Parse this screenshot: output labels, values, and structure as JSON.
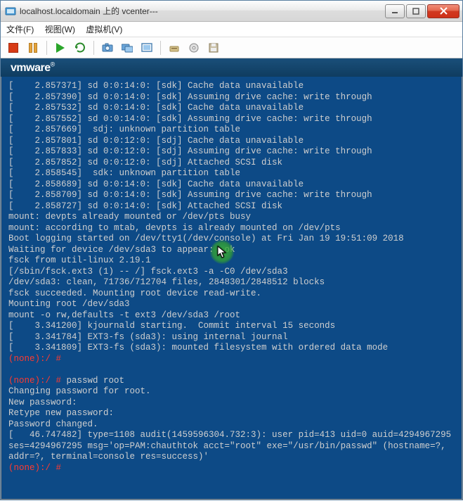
{
  "window": {
    "title": "localhost.localdomain 上的 vcenter---"
  },
  "menu": {
    "file": "文件(F)",
    "view": "视图(W)",
    "vm": "虚拟机(V)"
  },
  "toolbar_icons": {
    "stop": "stop-icon",
    "pause": "pause-icon",
    "play": "play-icon",
    "refresh": "refresh-icon",
    "snapshot": "snapshot-icon",
    "snapshot_mgr": "snapshot-manager-icon",
    "fullscreen": "fullscreen-icon",
    "eject": "eject-icon",
    "connect_cd": "connect-cd-icon",
    "connect_floppy": "connect-floppy-icon"
  },
  "vmware": {
    "brand": "vmware",
    "reg": "®"
  },
  "term": {
    "l01": "[    2.857371] sd 0:0:14:0: [sdk] Cache data unavailable",
    "l02": "[    2.857390] sd 0:0:14:0: [sdk] Assuming drive cache: write through",
    "l03": "[    2.857532] sd 0:0:14:0: [sdk] Cache data unavailable",
    "l04": "[    2.857552] sd 0:0:14:0: [sdk] Assuming drive cache: write through",
    "l05": "[    2.857669]  sdj: unknown partition table",
    "l06": "[    2.857801] sd 0:0:12:0: [sdj] Cache data unavailable",
    "l07": "[    2.857833] sd 0:0:12:0: [sdj] Assuming drive cache: write through",
    "l08": "[    2.857852] sd 0:0:12:0: [sdj] Attached SCSI disk",
    "l09": "[    2.858545]  sdk: unknown partition table",
    "l10": "[    2.858689] sd 0:0:14:0: [sdk] Cache data unavailable",
    "l11": "[    2.858709] sd 0:0:14:0: [sdk] Assuming drive cache: write through",
    "l12": "[    2.858727] sd 0:0:14:0: [sdk] Attached SCSI disk",
    "l13": "mount: devpts already mounted or /dev/pts busy",
    "l14": "mount: according to mtab, devpts is already mounted on /dev/pts",
    "l15": "Boot logging started on /dev/tty1(/dev/console) at Fri Jan 19 19:51:09 2018",
    "l16": "Waiting for device /dev/sda3 to appear:  ok",
    "l17": "fsck from util-linux 2.19.1",
    "l18": "[/sbin/fsck.ext3 (1) -- /] fsck.ext3 -a -C0 /dev/sda3",
    "l19": "/dev/sda3: clean, 71736/712704 files, 2848301/2848512 blocks",
    "l20": "fsck succeeded. Mounting root device read-write.",
    "l21": "Mounting root /dev/sda3",
    "l22": "mount -o rw,defaults -t ext3 /dev/sda3 /root",
    "l23": "[    3.341200] kjournald starting.  Commit interval 15 seconds",
    "l24": "[    3.341784] EXT3-fs (sda3): using internal journal",
    "l25": "[    3.341809] EXT3-fs (sda3): mounted filesystem with ordered data mode",
    "prompt1": "(none):/ #",
    "blank1": " ",
    "prompt2": "(none):/ #",
    "cmd_passwd": " passwd root",
    "l26": "Changing password for root.",
    "l27": "New password:",
    "l28": "Retype new password:",
    "l29": "Password changed.",
    "l30": "[   46.747482] type=1108 audit(1459596304.732:3): user pid=413 uid=0 auid=4294967295 ses=4294967295 msg='op=PAM:chauthtok acct=\"root\" exe=\"/usr/bin/passwd\" (hostname=?, addr=?, terminal=console res=success)'",
    "prompt3": "(none):/ #"
  }
}
